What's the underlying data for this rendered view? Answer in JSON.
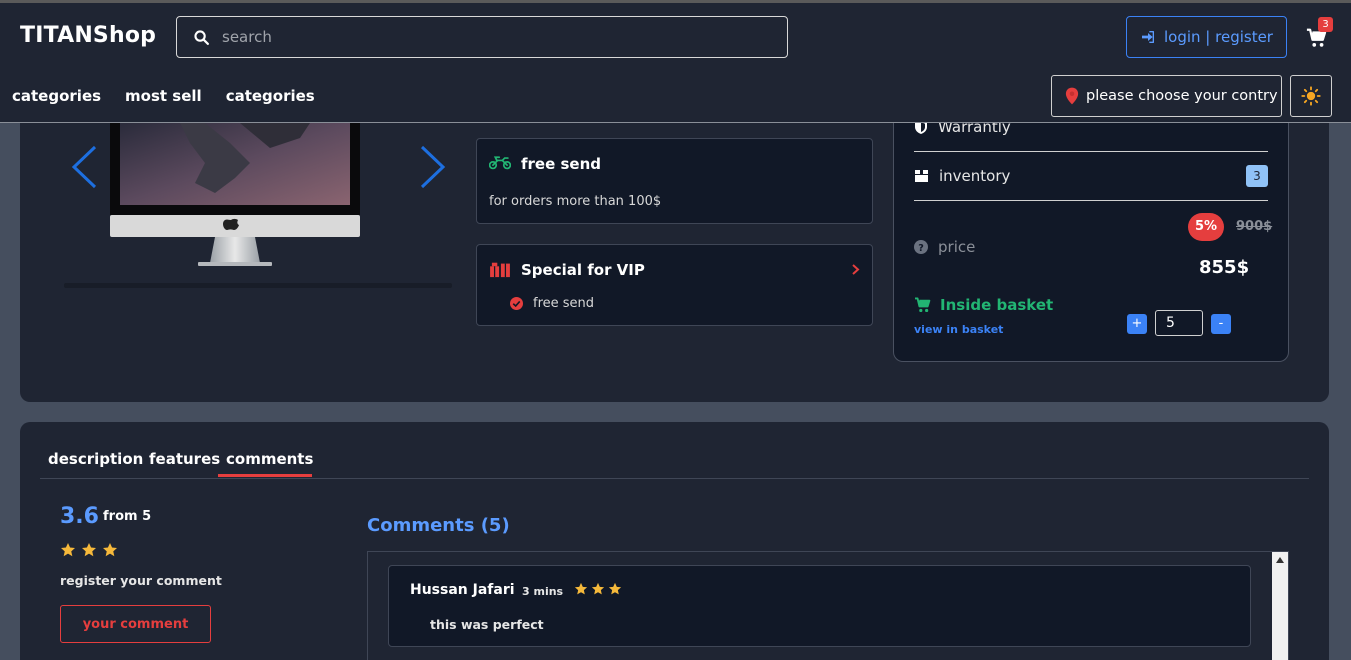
{
  "header": {
    "logo": "TITANShop",
    "search_placeholder": "search",
    "login_label": "login | register",
    "cart_count": "3",
    "nav": [
      "categories",
      "most sell",
      "categories"
    ],
    "country_label": "please choose your contry"
  },
  "product": {
    "features": [
      {
        "title": "free send",
        "subtitle": "for orders more than 100$"
      },
      {
        "title": "Special for VIP",
        "subtitle": "free send"
      }
    ],
    "warranty_label": "Warrantly",
    "inventory_label": "inventory",
    "inventory_count": "3",
    "price_label": "price",
    "discount": "5%",
    "old_price": "900$",
    "price": "855$",
    "in_basket_label": "Inside basket",
    "view_basket_label": "view in basket",
    "quantity": "5",
    "plus_label": "+",
    "minus_label": "-"
  },
  "tabs": {
    "items": [
      "description",
      "features",
      "comments"
    ],
    "active": "comments"
  },
  "review": {
    "rating": "3.6",
    "from_label": "from 5",
    "stars_filled": 3,
    "register_label": "register your comment",
    "your_comment_button": "your comment",
    "comments_title": "Comments (5)",
    "comments": [
      {
        "name": "Hussan Jafari",
        "time": "3 mins",
        "stars": 3,
        "text": "this was perfect"
      }
    ]
  },
  "colors": {
    "background": "#454e5e",
    "panel": "#1f2533",
    "accent_blue": "#3b82f6",
    "accent_red": "#e53e3e",
    "accent_green": "#22b573",
    "star": "#f6b93b"
  }
}
